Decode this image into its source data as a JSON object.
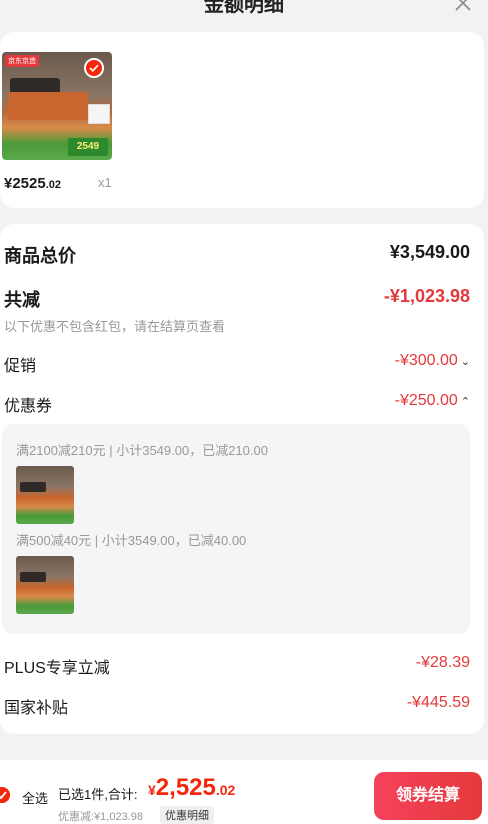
{
  "header": {
    "title": "金额明细"
  },
  "product": {
    "price_int": "¥2525",
    "price_dec": ".02",
    "qty": "x1",
    "tag": "京东京造",
    "badge": "2549"
  },
  "summary": {
    "total_label": "商品总价",
    "total_value": "¥3,549.00",
    "reduce_label": "共减",
    "reduce_value": "-¥1,023.98",
    "note": "以下优惠不包含红包，请在结算页查看",
    "promo_label": "促销",
    "promo_value": "-¥300.00",
    "coupon_label": "优惠券",
    "coupon_value": "-¥250.00",
    "coupon_lines": [
      "满2100减210元 | 小计3549.00，已减210.00",
      "满500减40元 | 小计3549.00，已减40.00"
    ],
    "plus_label": "PLUS专享立减",
    "plus_value": "-¥28.39",
    "gov_label": "国家补贴",
    "gov_value": "-¥445.59"
  },
  "bottom": {
    "select_all": "全选",
    "selected": "已选1件,合计:",
    "currency": "¥",
    "total_int": "2,525",
    "total_dec": ".02",
    "discount": "优惠减:¥1,023.98",
    "detail": "优惠明细",
    "checkout": "领券结算"
  },
  "colors": {
    "accent": "#f2270c",
    "red_text": "#e4393c"
  },
  "icons": {
    "close": "close-icon",
    "check": "check-icon",
    "chevron_down": "chevron-down-icon",
    "chevron_up": "chevron-up-icon"
  }
}
